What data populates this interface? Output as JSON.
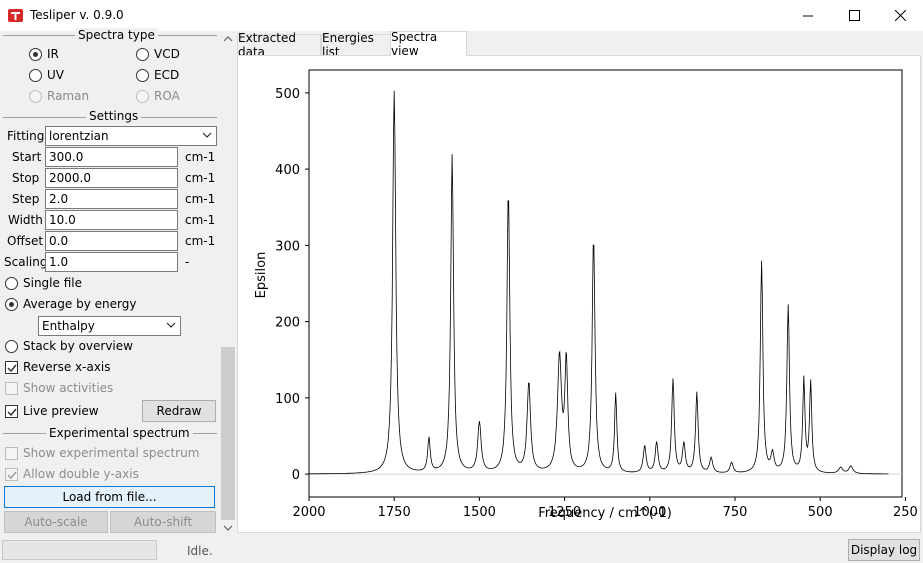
{
  "window": {
    "title": "Tesliper v. 0.9.0",
    "icon": "tesliper-logo-icon",
    "controls": [
      "minimize-icon",
      "maximize-icon",
      "close-icon"
    ]
  },
  "spectra_type": {
    "title": "Spectra type",
    "options": [
      {
        "label": "IR",
        "selected": true,
        "enabled": true
      },
      {
        "label": "VCD",
        "selected": false,
        "enabled": true
      },
      {
        "label": "UV",
        "selected": false,
        "enabled": true
      },
      {
        "label": "ECD",
        "selected": false,
        "enabled": true
      },
      {
        "label": "Raman",
        "selected": false,
        "enabled": false
      },
      {
        "label": "ROA",
        "selected": false,
        "enabled": false
      }
    ]
  },
  "settings": {
    "title": "Settings",
    "fitting": {
      "label": "Fitting",
      "value": "lorentzian"
    },
    "params": [
      {
        "label": "Start",
        "value": "300.0",
        "unit": "cm-1"
      },
      {
        "label": "Stop",
        "value": "2000.0",
        "unit": "cm-1"
      },
      {
        "label": "Step",
        "value": "2.0",
        "unit": "cm-1"
      },
      {
        "label": "Width",
        "value": "10.0",
        "unit": "cm-1"
      },
      {
        "label": "Offset",
        "value": "0.0",
        "unit": "cm-1"
      },
      {
        "label": "Scaling",
        "value": "1.0",
        "unit": "-"
      }
    ]
  },
  "mode": {
    "single_file": "Single file",
    "average_by_energy": "Average by energy",
    "energy_type": "Enthalpy",
    "stack_by_overview": "Stack by overview"
  },
  "options": {
    "reverse_x_axis": {
      "label": "Reverse x-axis",
      "checked": true
    },
    "show_activities": {
      "label": "Show activities",
      "checked": false,
      "enabled": false
    },
    "live_preview": {
      "label": "Live preview",
      "checked": true
    },
    "redraw": "Redraw"
  },
  "experimental": {
    "title": "Experimental spectrum",
    "show_experimental": {
      "label": "Show experimental spectrum",
      "checked": false,
      "enabled": false
    },
    "allow_double_y": {
      "label": "Allow double y-axis",
      "checked": true,
      "enabled": false
    },
    "load_button": "Load from file...",
    "auto_scale": "Auto-scale",
    "auto_shift": "Auto-shift"
  },
  "tabs": [
    "Extracted data",
    "Energies list",
    "Spectra view"
  ],
  "active_tab": "Spectra view",
  "status": {
    "text": "Idle.",
    "display_log": "Display log"
  },
  "chart_data": {
    "type": "line",
    "xlabel": "Frequency / cm^(-1)",
    "ylabel": "Epsilon",
    "xlim": [
      2000,
      260
    ],
    "ylim": [
      -30,
      530
    ],
    "x_reversed": true,
    "x_ticks": [
      "2000",
      "1750",
      "1500",
      "1250",
      "1000",
      "750",
      "500",
      "250"
    ],
    "y_ticks": [
      "0",
      "100",
      "200",
      "300",
      "400",
      "500"
    ],
    "line_color": "#000000",
    "zero_line_color": "#c8c8c8",
    "peaks": [
      {
        "x": 1750,
        "y": 502,
        "w": 11
      },
      {
        "x": 1648,
        "y": 45,
        "w": 9
      },
      {
        "x": 1580,
        "y": 418,
        "w": 10
      },
      {
        "x": 1500,
        "y": 66,
        "w": 12
      },
      {
        "x": 1415,
        "y": 370,
        "w": 10
      },
      {
        "x": 1355,
        "y": 118,
        "w": 12
      },
      {
        "x": 1265,
        "y": 152,
        "w": 14
      },
      {
        "x": 1245,
        "y": 145,
        "w": 10
      },
      {
        "x": 1165,
        "y": 310,
        "w": 10
      },
      {
        "x": 1100,
        "y": 104,
        "w": 8
      },
      {
        "x": 1015,
        "y": 36,
        "w": 10
      },
      {
        "x": 980,
        "y": 40,
        "w": 10
      },
      {
        "x": 932,
        "y": 123,
        "w": 9
      },
      {
        "x": 900,
        "y": 38,
        "w": 10
      },
      {
        "x": 862,
        "y": 106,
        "w": 9
      },
      {
        "x": 820,
        "y": 20,
        "w": 11
      },
      {
        "x": 760,
        "y": 14,
        "w": 11
      },
      {
        "x": 672,
        "y": 278,
        "w": 9
      },
      {
        "x": 640,
        "y": 24,
        "w": 11
      },
      {
        "x": 594,
        "y": 220,
        "w": 9
      },
      {
        "x": 548,
        "y": 122,
        "w": 8
      },
      {
        "x": 528,
        "y": 118,
        "w": 8
      },
      {
        "x": 440,
        "y": 8,
        "w": 14
      },
      {
        "x": 410,
        "y": 10,
        "w": 14
      }
    ]
  }
}
